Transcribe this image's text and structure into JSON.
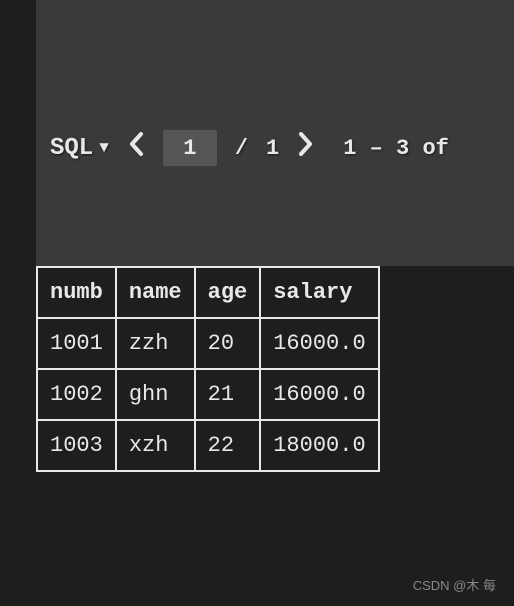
{
  "toolbar": {
    "sql_label": "SQL",
    "page_current": "1",
    "page_separator": "/",
    "page_total": "1",
    "range_text": "1 – 3 of"
  },
  "table": {
    "headers": [
      "numb",
      "name",
      "age",
      "salary"
    ],
    "rows": [
      [
        "1001",
        "zzh",
        "20",
        "16000.0"
      ],
      [
        "1002",
        "ghn",
        "21",
        "16000.0"
      ],
      [
        "1003",
        "xzh",
        "22",
        "18000.0"
      ]
    ]
  },
  "watermark": "CSDN @木 每"
}
